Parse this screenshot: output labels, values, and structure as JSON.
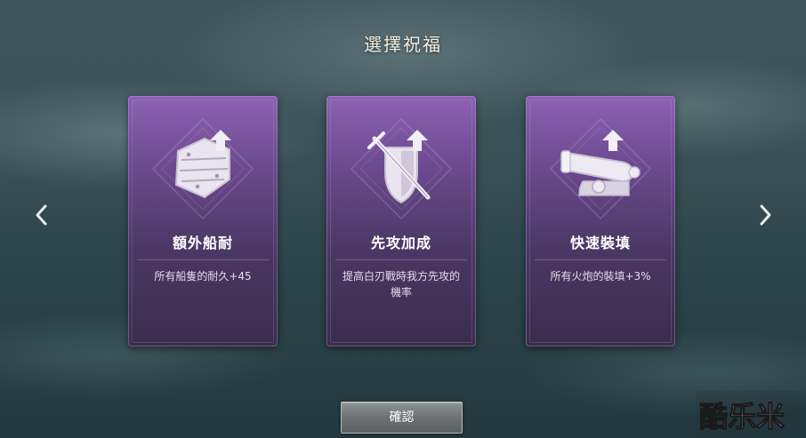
{
  "title": "選擇祝福",
  "navigation": {
    "prev_icon": "chevron-left-icon",
    "next_icon": "chevron-right-icon"
  },
  "cards": [
    {
      "icon": "wooden-hull-plate-upgrade-icon",
      "name": "額外船耐",
      "description": "所有船隻的耐久+45"
    },
    {
      "icon": "sword-shield-upgrade-icon",
      "name": "先攻加成",
      "description": "提高白刃戰時我方先攻的機率"
    },
    {
      "icon": "cannon-upgrade-icon",
      "name": "快速裝填",
      "description": "所有火炮的裝填+3%"
    }
  ],
  "confirm_label": "確認",
  "watermark": "酷乐米",
  "colors": {
    "card_top": "#8c62b3",
    "card_bottom": "#3a2d4d",
    "title_text": "#f4efe0",
    "button_face": "#6e7172"
  }
}
